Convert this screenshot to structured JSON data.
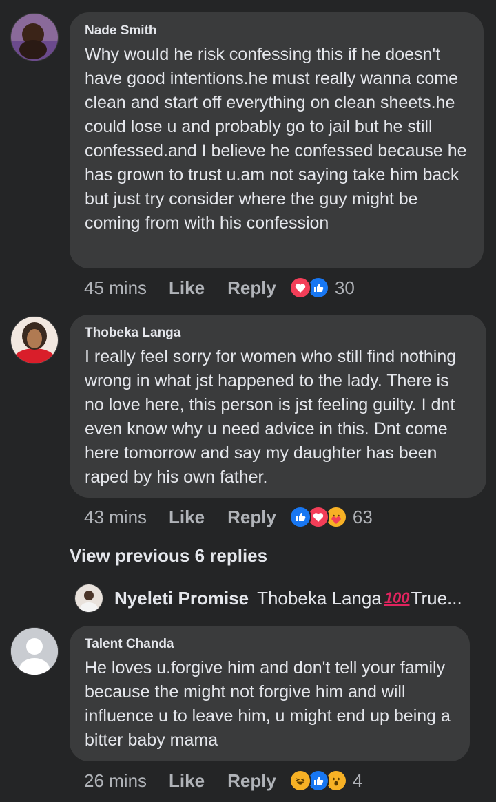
{
  "comments": [
    {
      "author": "Nade Smith",
      "text": "Why would he risk confessing this if he doesn't have good intentions.he must really wanna come clean and start off everything on clean sheets.he could lose u and probably go to jail but he still confessed.and I believe he confessed because he has grown to trust u.am not saying take him back but just try consider where the guy might be coming from with his confession",
      "time": "45 mins",
      "like_label": "Like",
      "reply_label": "Reply",
      "reactions": [
        "love-icon",
        "like-icon"
      ],
      "reaction_count": "30"
    },
    {
      "author": "Thobeka Langa",
      "text": "I really feel sorry for women who still find nothing wrong in what jst happened to the lady. There is no love here, this person is jst feeling guilty. I dnt even know why u need advice in this. Dnt come here tomorrow and say my daughter has been raped by his own father.",
      "time": "43 mins",
      "like_label": "Like",
      "reply_label": "Reply",
      "reactions": [
        "like-icon",
        "love-icon",
        "care-icon"
      ],
      "reaction_count": "63"
    },
    {
      "author": "Talent Chanda",
      "text": "He loves  u.forgive him and don't tell your family because the might not forgive him and will influence u to leave him, u might end up being a bitter baby mama",
      "time": "26 mins",
      "like_label": "Like",
      "reply_label": "Reply",
      "reactions": [
        "haha-icon",
        "like-icon",
        "wow-icon"
      ],
      "reaction_count": "4"
    }
  ],
  "view_previous": "View previous 6 replies",
  "reply_preview": {
    "author": "Nyeleti Promise",
    "mention": "Thobeka Langa",
    "emoji": "100",
    "text": "True..."
  }
}
